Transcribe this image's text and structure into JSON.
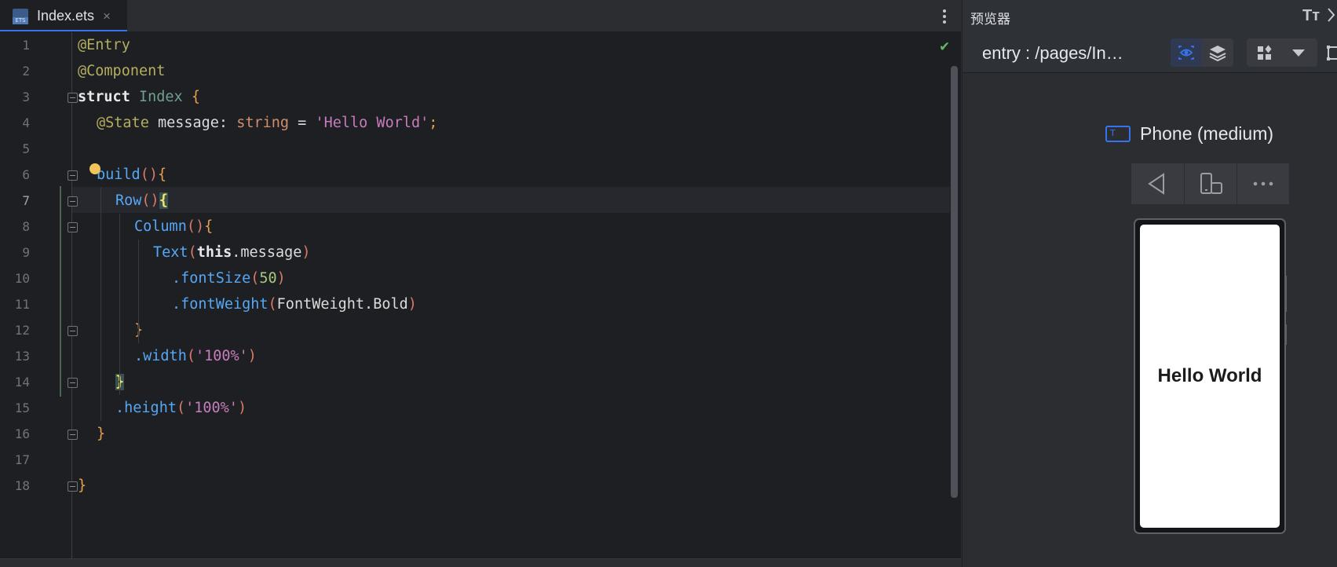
{
  "editor": {
    "tab": {
      "title": "Index.ets",
      "close": "×",
      "icon_label": "ETS"
    },
    "status_check": "✔",
    "current_line": 7,
    "lines": [
      {
        "n": "1",
        "indent": 0,
        "tokens": [
          {
            "t": "@Entry",
            "c": "ann"
          }
        ]
      },
      {
        "n": "2",
        "indent": 0,
        "tokens": [
          {
            "t": "@Component",
            "c": "ann"
          }
        ]
      },
      {
        "n": "3",
        "indent": 0,
        "tokens": [
          {
            "t": "struct",
            "c": "kwb"
          },
          {
            "t": " ",
            "c": "txt"
          },
          {
            "t": "Index",
            "c": "cls"
          },
          {
            "t": " ",
            "c": "txt"
          },
          {
            "t": "{",
            "c": "br"
          }
        ]
      },
      {
        "n": "4",
        "indent": 1,
        "tokens": [
          {
            "t": "@State",
            "c": "ann"
          },
          {
            "t": " message: ",
            "c": "txt"
          },
          {
            "t": "string",
            "c": "kw"
          },
          {
            "t": " = ",
            "c": "txt"
          },
          {
            "t": "'Hello World'",
            "c": "str"
          },
          {
            "t": ";",
            "c": "br"
          }
        ]
      },
      {
        "n": "5",
        "indent": 0,
        "tokens": []
      },
      {
        "n": "6",
        "indent": 1,
        "tokens": [
          {
            "t": "build",
            "c": "fn"
          },
          {
            "t": "()",
            "c": "paren"
          },
          {
            "t": "{",
            "c": "br"
          }
        ]
      },
      {
        "n": "7",
        "indent": 2,
        "tokens": [
          {
            "t": "Row",
            "c": "fn"
          },
          {
            "t": "()",
            "c": "paren"
          },
          {
            "t": "{",
            "c": "brhl"
          }
        ]
      },
      {
        "n": "8",
        "indent": 3,
        "tokens": [
          {
            "t": "Column",
            "c": "fn"
          },
          {
            "t": "()",
            "c": "paren"
          },
          {
            "t": "{",
            "c": "br"
          }
        ]
      },
      {
        "n": "9",
        "indent": 4,
        "tokens": [
          {
            "t": "Text",
            "c": "fn"
          },
          {
            "t": "(",
            "c": "paren"
          },
          {
            "t": "this",
            "c": "kwb"
          },
          {
            "t": ".message",
            "c": "txt"
          },
          {
            "t": ")",
            "c": "paren"
          }
        ]
      },
      {
        "n": "10",
        "indent": 5,
        "tokens": [
          {
            "t": ".fontSize",
            "c": "fn"
          },
          {
            "t": "(",
            "c": "paren"
          },
          {
            "t": "50",
            "c": "num"
          },
          {
            "t": ")",
            "c": "paren"
          }
        ]
      },
      {
        "n": "11",
        "indent": 5,
        "tokens": [
          {
            "t": ".fontWeight",
            "c": "fn"
          },
          {
            "t": "(",
            "c": "paren"
          },
          {
            "t": "FontWeight.Bold",
            "c": "txt"
          },
          {
            "t": ")",
            "c": "paren"
          }
        ]
      },
      {
        "n": "12",
        "indent": 3,
        "tokens": [
          {
            "t": "}",
            "c": "br"
          }
        ]
      },
      {
        "n": "13",
        "indent": 3,
        "tokens": [
          {
            "t": ".width",
            "c": "fn"
          },
          {
            "t": "(",
            "c": "paren"
          },
          {
            "t": "'100%'",
            "c": "str"
          },
          {
            "t": ")",
            "c": "paren"
          }
        ]
      },
      {
        "n": "14",
        "indent": 2,
        "tokens": [
          {
            "t": "}",
            "c": "brhl"
          }
        ]
      },
      {
        "n": "15",
        "indent": 2,
        "tokens": [
          {
            "t": ".height",
            "c": "fn"
          },
          {
            "t": "(",
            "c": "paren"
          },
          {
            "t": "'100%'",
            "c": "str"
          },
          {
            "t": ")",
            "c": "paren"
          }
        ]
      },
      {
        "n": "16",
        "indent": 1,
        "tokens": [
          {
            "t": "}",
            "c": "br"
          }
        ]
      },
      {
        "n": "17",
        "indent": 0,
        "tokens": []
      },
      {
        "n": "18",
        "indent": 0,
        "tokens": [
          {
            "t": "}",
            "c": "br"
          }
        ]
      }
    ],
    "fold_markers_on_lines": [
      3,
      6,
      7,
      8,
      12,
      14,
      16,
      18
    ],
    "intention_bulb_line": 6
  },
  "syntax_colors": {
    "ann": "#b3ae60",
    "kwb": "#e8e8e8",
    "kw": "#cf8e6d",
    "cls": "#6f9f8f",
    "txt": "#dcdcdc",
    "str": "#c77dbb",
    "fn": "#56a8f5",
    "paren": "#d77a6a",
    "br": "#e6a04b",
    "brhl": "#f2e56b",
    "num": "#a9c87f"
  },
  "preview": {
    "title": "预览器",
    "font_icon": "Tт",
    "route": "entry : /pages/In…",
    "device_name": "Phone (medium)",
    "device_icon_letter": "T",
    "screen_text": "Hello World",
    "icons": {
      "inspector": "eye-focus-icon",
      "layers": "layers-icon",
      "grid": "component-grid-icon",
      "dropdown": "caret-down-icon",
      "frame": "frame-icon",
      "back": "back-triangle-icon",
      "rotate": "rotate-device-icon",
      "more": "more-horizontal-icon"
    },
    "accent": "#3574f0"
  }
}
